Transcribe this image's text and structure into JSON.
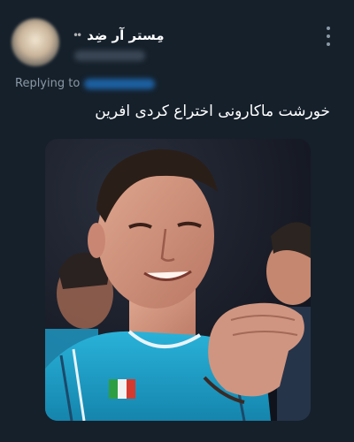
{
  "author": {
    "display_name": "مِستر آر ضِد",
    "name_emoji": "••",
    "avatar_icon": "user-avatar-blurred",
    "handle": ""
  },
  "menu_icon": "more-vertical-icon",
  "reply": {
    "label": "Replying to"
  },
  "tweet": {
    "text": "خورشت ماکارونی اختراع کردی افرین"
  },
  "media": {
    "alt": "Footballer in a light blue and navy striped jersey laughing with hand raised near mouth",
    "jersey_color": "#1aa0c8",
    "background_color": "#1a1f2b"
  },
  "colors": {
    "background": "#15202b",
    "text_primary": "#ffffff",
    "text_secondary": "#8b98a5",
    "link": "#1d9bf0"
  }
}
